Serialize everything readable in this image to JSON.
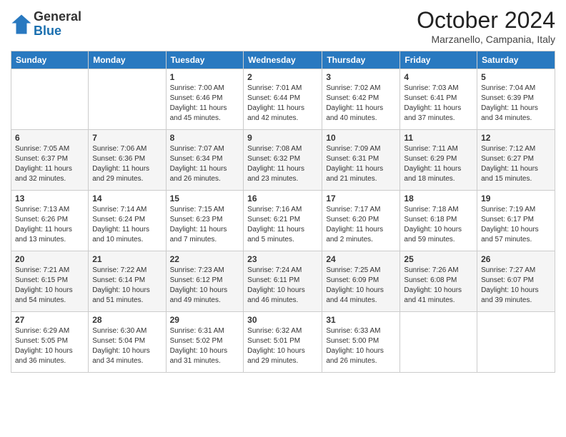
{
  "header": {
    "logo_general": "General",
    "logo_blue": "Blue",
    "month_title": "October 2024",
    "location": "Marzanello, Campania, Italy"
  },
  "days_of_week": [
    "Sunday",
    "Monday",
    "Tuesday",
    "Wednesday",
    "Thursday",
    "Friday",
    "Saturday"
  ],
  "weeks": [
    [
      {
        "day": "",
        "info": ""
      },
      {
        "day": "",
        "info": ""
      },
      {
        "day": "1",
        "info": "Sunrise: 7:00 AM\nSunset: 6:46 PM\nDaylight: 11 hours and 45 minutes."
      },
      {
        "day": "2",
        "info": "Sunrise: 7:01 AM\nSunset: 6:44 PM\nDaylight: 11 hours and 42 minutes."
      },
      {
        "day": "3",
        "info": "Sunrise: 7:02 AM\nSunset: 6:42 PM\nDaylight: 11 hours and 40 minutes."
      },
      {
        "day": "4",
        "info": "Sunrise: 7:03 AM\nSunset: 6:41 PM\nDaylight: 11 hours and 37 minutes."
      },
      {
        "day": "5",
        "info": "Sunrise: 7:04 AM\nSunset: 6:39 PM\nDaylight: 11 hours and 34 minutes."
      }
    ],
    [
      {
        "day": "6",
        "info": "Sunrise: 7:05 AM\nSunset: 6:37 PM\nDaylight: 11 hours and 32 minutes."
      },
      {
        "day": "7",
        "info": "Sunrise: 7:06 AM\nSunset: 6:36 PM\nDaylight: 11 hours and 29 minutes."
      },
      {
        "day": "8",
        "info": "Sunrise: 7:07 AM\nSunset: 6:34 PM\nDaylight: 11 hours and 26 minutes."
      },
      {
        "day": "9",
        "info": "Sunrise: 7:08 AM\nSunset: 6:32 PM\nDaylight: 11 hours and 23 minutes."
      },
      {
        "day": "10",
        "info": "Sunrise: 7:09 AM\nSunset: 6:31 PM\nDaylight: 11 hours and 21 minutes."
      },
      {
        "day": "11",
        "info": "Sunrise: 7:11 AM\nSunset: 6:29 PM\nDaylight: 11 hours and 18 minutes."
      },
      {
        "day": "12",
        "info": "Sunrise: 7:12 AM\nSunset: 6:27 PM\nDaylight: 11 hours and 15 minutes."
      }
    ],
    [
      {
        "day": "13",
        "info": "Sunrise: 7:13 AM\nSunset: 6:26 PM\nDaylight: 11 hours and 13 minutes."
      },
      {
        "day": "14",
        "info": "Sunrise: 7:14 AM\nSunset: 6:24 PM\nDaylight: 11 hours and 10 minutes."
      },
      {
        "day": "15",
        "info": "Sunrise: 7:15 AM\nSunset: 6:23 PM\nDaylight: 11 hours and 7 minutes."
      },
      {
        "day": "16",
        "info": "Sunrise: 7:16 AM\nSunset: 6:21 PM\nDaylight: 11 hours and 5 minutes."
      },
      {
        "day": "17",
        "info": "Sunrise: 7:17 AM\nSunset: 6:20 PM\nDaylight: 11 hours and 2 minutes."
      },
      {
        "day": "18",
        "info": "Sunrise: 7:18 AM\nSunset: 6:18 PM\nDaylight: 10 hours and 59 minutes."
      },
      {
        "day": "19",
        "info": "Sunrise: 7:19 AM\nSunset: 6:17 PM\nDaylight: 10 hours and 57 minutes."
      }
    ],
    [
      {
        "day": "20",
        "info": "Sunrise: 7:21 AM\nSunset: 6:15 PM\nDaylight: 10 hours and 54 minutes."
      },
      {
        "day": "21",
        "info": "Sunrise: 7:22 AM\nSunset: 6:14 PM\nDaylight: 10 hours and 51 minutes."
      },
      {
        "day": "22",
        "info": "Sunrise: 7:23 AM\nSunset: 6:12 PM\nDaylight: 10 hours and 49 minutes."
      },
      {
        "day": "23",
        "info": "Sunrise: 7:24 AM\nSunset: 6:11 PM\nDaylight: 10 hours and 46 minutes."
      },
      {
        "day": "24",
        "info": "Sunrise: 7:25 AM\nSunset: 6:09 PM\nDaylight: 10 hours and 44 minutes."
      },
      {
        "day": "25",
        "info": "Sunrise: 7:26 AM\nSunset: 6:08 PM\nDaylight: 10 hours and 41 minutes."
      },
      {
        "day": "26",
        "info": "Sunrise: 7:27 AM\nSunset: 6:07 PM\nDaylight: 10 hours and 39 minutes."
      }
    ],
    [
      {
        "day": "27",
        "info": "Sunrise: 6:29 AM\nSunset: 5:05 PM\nDaylight: 10 hours and 36 minutes."
      },
      {
        "day": "28",
        "info": "Sunrise: 6:30 AM\nSunset: 5:04 PM\nDaylight: 10 hours and 34 minutes."
      },
      {
        "day": "29",
        "info": "Sunrise: 6:31 AM\nSunset: 5:02 PM\nDaylight: 10 hours and 31 minutes."
      },
      {
        "day": "30",
        "info": "Sunrise: 6:32 AM\nSunset: 5:01 PM\nDaylight: 10 hours and 29 minutes."
      },
      {
        "day": "31",
        "info": "Sunrise: 6:33 AM\nSunset: 5:00 PM\nDaylight: 10 hours and 26 minutes."
      },
      {
        "day": "",
        "info": ""
      },
      {
        "day": "",
        "info": ""
      }
    ]
  ]
}
